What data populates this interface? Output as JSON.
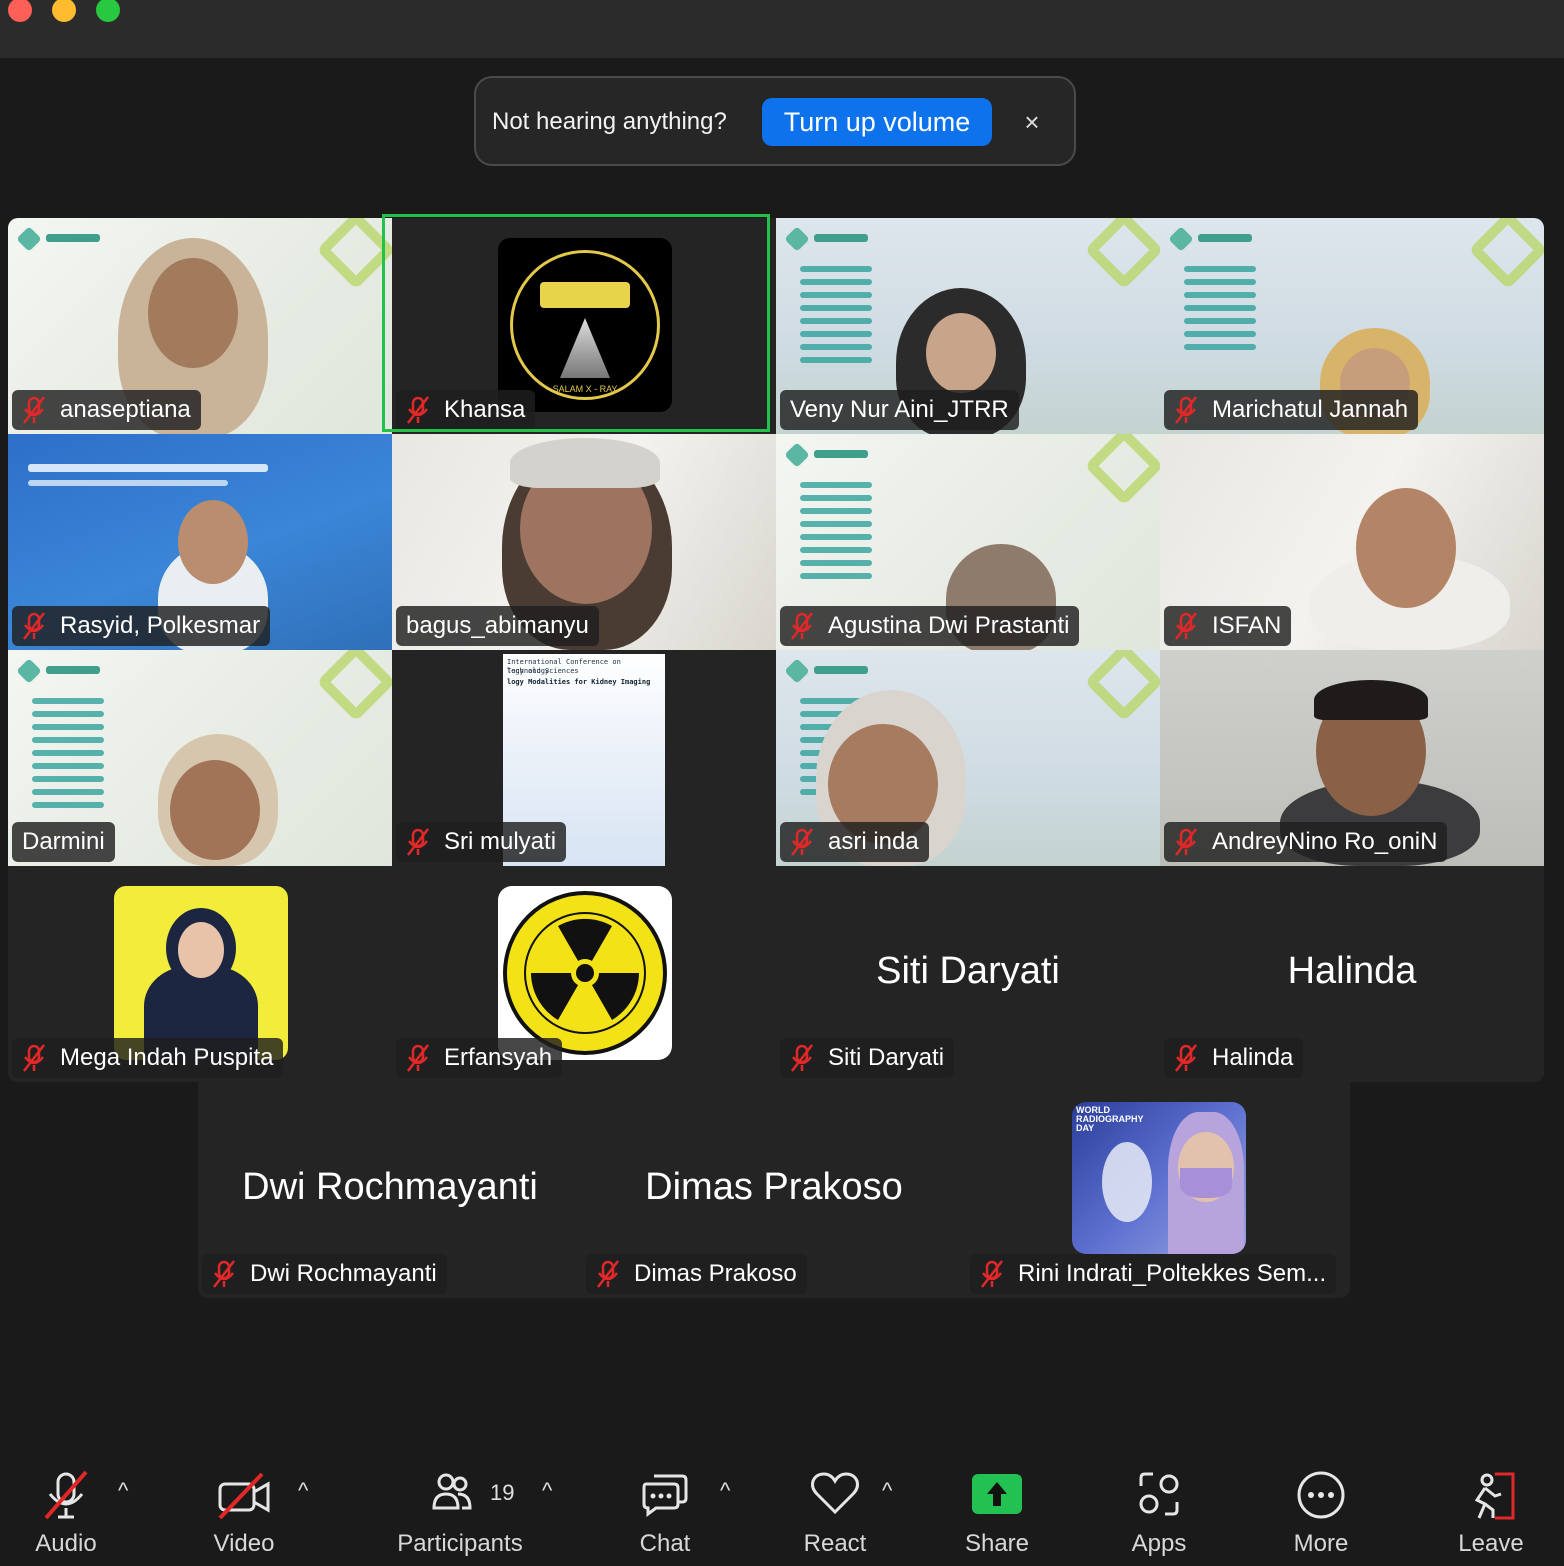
{
  "banner": {
    "message": "Not hearing anything?",
    "button": "Turn up volume",
    "close": "×"
  },
  "participants": [
    {
      "name": "anaseptiana",
      "muted": true
    },
    {
      "name": "Khansa",
      "muted": true
    },
    {
      "name": "Veny Nur Aini_JTRR",
      "muted": false
    },
    {
      "name": "Marichatul Jannah",
      "muted": true
    },
    {
      "name": "Rasyid, Polkesmar",
      "muted": true
    },
    {
      "name": "bagus_abimanyu",
      "muted": false,
      "speaking": true
    },
    {
      "name": "Agustina Dwi Prastanti",
      "muted": true
    },
    {
      "name": "ISFAN",
      "muted": true
    },
    {
      "name": "Darmini",
      "muted": false
    },
    {
      "name": "Sri mulyati",
      "muted": true
    },
    {
      "name": "asri inda",
      "muted": true
    },
    {
      "name": "AndreyNino Ro_oniN",
      "muted": true
    },
    {
      "name": "Mega Indah Puspita",
      "muted": true
    },
    {
      "name": "Erfansyah",
      "muted": true
    },
    {
      "name": "Siti Daryati",
      "muted": true,
      "video_off_name": "Siti Daryati"
    },
    {
      "name": "Halinda",
      "muted": true,
      "video_off_name": "Halinda"
    },
    {
      "name": "Dwi Rochmayanti",
      "muted": true,
      "video_off_name": "Dwi Rochmayanti"
    },
    {
      "name": "Dimas Prakoso",
      "muted": true,
      "video_off_name": "Dimas Prakoso"
    },
    {
      "name": "Rini Indrati_Poltekkes Sem...",
      "muted": true
    }
  ],
  "slide_texts": {
    "conference_title_1": "International Conference on Technology",
    "conference_title_2": "logy and Sciences",
    "conference_subtitle": "logy Modalities for Kidney Imaging",
    "logo_text": "SALAM X - RAY",
    "rini_poster": "WORLD RADIOGRAPHY DAY"
  },
  "toolbar": {
    "audio": "Audio",
    "video": "Video",
    "participants": "Participants",
    "participants_count": "19",
    "chat": "Chat",
    "react": "React",
    "share": "Share",
    "apps": "Apps",
    "more": "More",
    "leave": "Leave",
    "caret": "^"
  },
  "colors": {
    "accent": "#0e72ed",
    "active_speaker": "#24c14a",
    "mute_red": "#e02828",
    "share_green": "#23c151"
  }
}
